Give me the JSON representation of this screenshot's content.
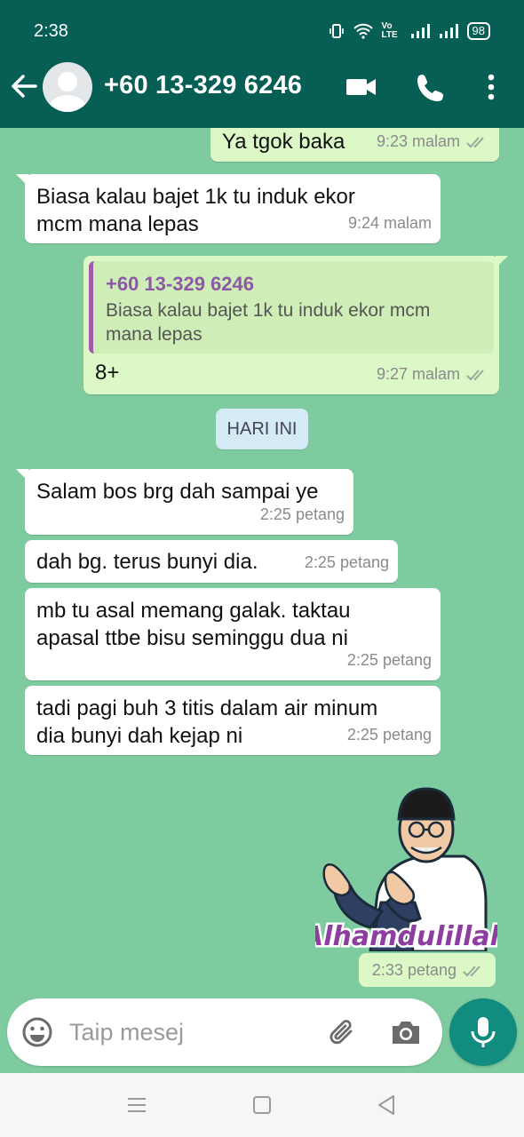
{
  "status_bar": {
    "time": "2:38",
    "network_label": "Vo LTE",
    "battery": "98"
  },
  "header": {
    "contact_name": "+60 13-329 6246",
    "back_icon": "arrow-left-icon",
    "video_icon": "video-camera-icon",
    "call_icon": "phone-icon",
    "menu_icon": "more-vert-icon"
  },
  "messages": [
    {
      "direction": "outgoing",
      "text": "Ya tgok baka",
      "time": "9:23 malam",
      "status": "read"
    },
    {
      "direction": "incoming",
      "lines": [
        "Biasa kalau bajet 1k tu induk ekor",
        "mcm mana lepas"
      ],
      "time": "9:24 malam"
    },
    {
      "direction": "outgoing",
      "quote": {
        "sender": "+60 13-329 6246",
        "lines": [
          "Biasa kalau bajet 1k tu induk ekor mcm",
          "mana lepas"
        ]
      },
      "text": "8+",
      "time": "9:27 malam",
      "status": "read"
    },
    {
      "direction": "incoming",
      "text": "Salam bos brg dah sampai ye",
      "time": "2:25 petang"
    },
    {
      "direction": "incoming",
      "text": "dah bg. terus bunyi dia.",
      "time": "2:25 petang"
    },
    {
      "direction": "incoming",
      "lines": [
        "mb tu asal memang galak. taktau",
        "apasal ttbe bisu seminggu dua ni"
      ],
      "time": "2:25 petang"
    },
    {
      "direction": "incoming",
      "lines": [
        "tadi pagi buh 3 titis dalam air minum",
        "dia bunyi dah kejap ni"
      ],
      "time": "2:25 petang"
    }
  ],
  "day_separator": "HARI INI",
  "sticker": {
    "caption": "Alhamdulillah",
    "time": "2:33 petang",
    "status": "read"
  },
  "input": {
    "placeholder": "Taip mesej",
    "emoji_icon": "emoji-icon",
    "attach_icon": "paperclip-icon",
    "camera_icon": "camera-icon",
    "mic_icon": "microphone-icon"
  },
  "colors": {
    "header": "#075e54",
    "chat_background": "#7fcba0",
    "outgoing_bubble": "#dcf8c6",
    "incoming_bubble": "#ffffff",
    "mic_button": "#128c7e",
    "quote_accent": "#a05ca8"
  }
}
